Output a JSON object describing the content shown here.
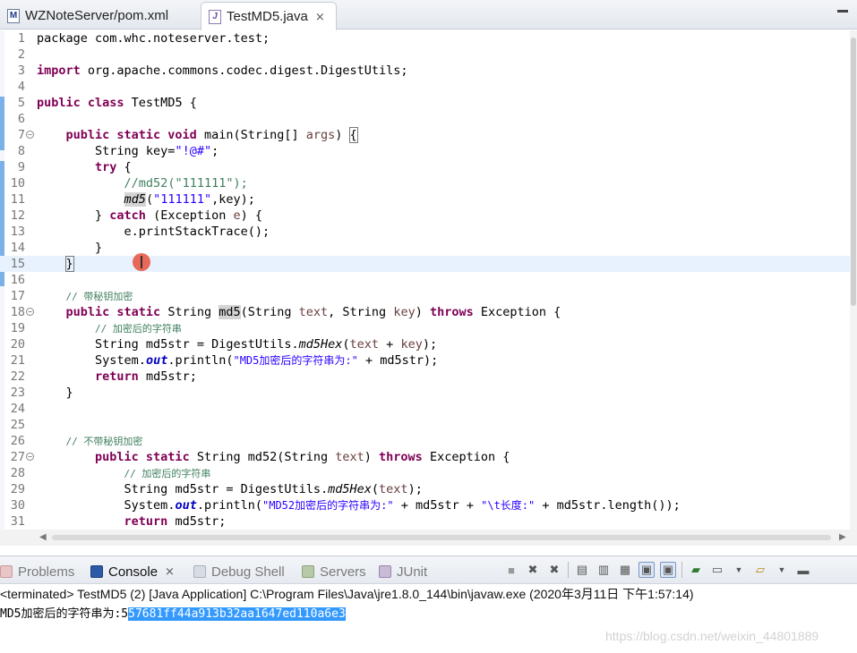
{
  "tabs": [
    {
      "label": "WZNoteServer/pom.xml",
      "icon": "maven-xml-file-icon",
      "active": false
    },
    {
      "label": "TestMD5.java",
      "icon": "java-file-icon",
      "active": true,
      "close": "⨯"
    }
  ],
  "editor": {
    "lines": [
      {
        "n": "1"
      },
      {
        "n": "2"
      },
      {
        "n": "3"
      },
      {
        "n": "4"
      },
      {
        "n": "5"
      },
      {
        "n": "6"
      },
      {
        "n": "7",
        "fold": "⊖"
      },
      {
        "n": "8"
      },
      {
        "n": "9"
      },
      {
        "n": "10"
      },
      {
        "n": "11"
      },
      {
        "n": "12"
      },
      {
        "n": "13"
      },
      {
        "n": "14"
      },
      {
        "n": "15"
      },
      {
        "n": "16"
      },
      {
        "n": "17"
      },
      {
        "n": "18",
        "fold": "⊖"
      },
      {
        "n": "19"
      },
      {
        "n": "20"
      },
      {
        "n": "21"
      },
      {
        "n": "22"
      },
      {
        "n": "23"
      },
      {
        "n": "24"
      },
      {
        "n": "25"
      },
      {
        "n": "26"
      },
      {
        "n": "27",
        "fold": "⊖"
      },
      {
        "n": "28"
      },
      {
        "n": "29"
      },
      {
        "n": "30"
      },
      {
        "n": "31"
      }
    ],
    "text": {
      "l1": "package com.whc.noteserver.test;",
      "l3_kw": "import",
      "l3": " org.apache.commons.codec.digest.DigestUtils;",
      "l5_kw": "public class",
      "l5": " TestMD5 {",
      "l7_kw": "public static void",
      "l7a": " main(String[] ",
      "l7_args": "args",
      "l7b": ") ",
      "l7_brace": "{",
      "l8a": "String key=",
      "l8_str": "\"!@#\"",
      "l8b": ";",
      "l9_kw": "try",
      "l9": " {",
      "l10_cmt": "//md52(\"111111\");",
      "l11_call": "md5",
      "l11a": "(",
      "l11_str": "\"111111\"",
      "l11b": ",key);",
      "l12a": "} ",
      "l12_kw": "catch",
      "l12b": " (Exception ",
      "l12_e": "e",
      "l12c": ") {",
      "l13": "e.printStackTrace();",
      "l14": "}",
      "l15": "}",
      "l17_cmt": "// 带秘钥加密",
      "l18_kw": "public static",
      "l18a": " String ",
      "l18_name": "md5",
      "l18b": "(String ",
      "l18_p1": "text",
      "l18c": ", String ",
      "l18_p2": "key",
      "l18d": ") ",
      "l18_throws": "throws",
      "l18e": " Exception {",
      "l19_cmt": "// 加密后的字符串",
      "l20a": "String md5str = DigestUtils.",
      "l20_m": "md5Hex",
      "l20b": "(",
      "l20_p1": "text",
      "l20c": " + ",
      "l20_p2": "key",
      "l20d": ");",
      "l21a": "System.",
      "l21_out": "out",
      "l21b": ".println(",
      "l21_str": "\"MD5加密后的字符串为:\"",
      "l21c": " + md5str);",
      "l22_kw": "return",
      "l22": " md5str;",
      "l23": "}",
      "l26_cmt": "// 不带秘钥加密",
      "l27_kw": "public static",
      "l27a": " String md52(String ",
      "l27_p": "text",
      "l27b": ") ",
      "l27_throws": "throws",
      "l27c": " Exception {",
      "l28_cmt": "// 加密后的字符串",
      "l29a": "String md5str = DigestUtils.",
      "l29_m": "md5Hex",
      "l29b": "(",
      "l29_p": "text",
      "l29c": ");",
      "l30a": "System.",
      "l30_out": "out",
      "l30b": ".println(",
      "l30_str1": "\"MD52加密后的字符串为:\"",
      "l30c": " + md5str + ",
      "l30_str2": "\"\\t长度:\"",
      "l30d": " + md5str.length());",
      "l31_kw": "return",
      "l31": " md5str;"
    }
  },
  "console_tabs": [
    {
      "label": "Problems",
      "icon": "problems-icon",
      "active": false
    },
    {
      "label": "Console",
      "icon": "console-icon",
      "active": true,
      "close": "⨯"
    },
    {
      "label": "Debug Shell",
      "icon": "debug-shell-icon",
      "active": false
    },
    {
      "label": "Servers",
      "icon": "servers-icon",
      "active": false
    },
    {
      "label": "JUnit",
      "icon": "junit-icon",
      "active": false
    }
  ],
  "console": {
    "header": "<terminated> TestMD5 (2) [Java Application] C:\\Program Files\\Java\\jre1.8.0_144\\bin\\javaw.exe (2020年3月11日 下午1:57:14)",
    "output_prefix": "MD5加密后的字符串为:5",
    "output_selected": "57681ff44a913b32aa1647ed110a6e3"
  },
  "watermark": "https://blog.csdn.net/weixin_44801889",
  "colors": {
    "keyword": "#7f0055",
    "string": "#2a00ff",
    "comment": "#3f7f5f",
    "field": "#0000c0",
    "current_line": "#e8f2fe",
    "selection": "#3399ff"
  }
}
